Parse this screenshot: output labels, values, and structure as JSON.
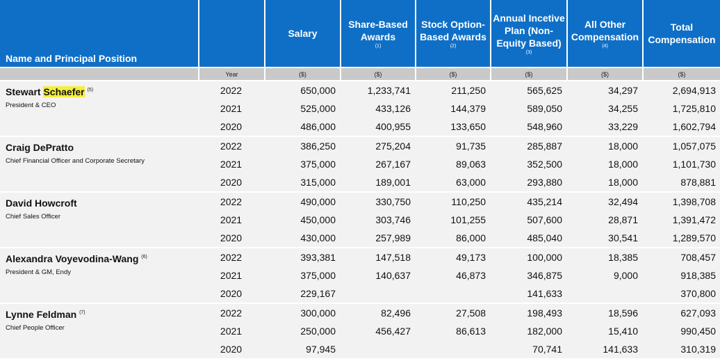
{
  "header": {
    "name_col": "Name and Principal Position",
    "salary": "Salary",
    "share_based": "Share-Based Awards",
    "share_based_note": "(1)",
    "option_based": "Stock Option-Based Awards",
    "option_based_note": "(2)",
    "incentive": "Annual Incetive Plan (Non-Equity Based)",
    "incentive_note": "(3)",
    "other": "All Other Compensation",
    "other_note": "(4)",
    "total": "Total Compensation"
  },
  "units": {
    "year": "Year",
    "salary": "($)",
    "share_based": "($)",
    "option_based": "($)",
    "incentive": "($)",
    "other": "($)",
    "total": "($)"
  },
  "people": [
    {
      "name_pre": "Stewart ",
      "name_highlight": "Schaefer",
      "name_post": "",
      "footnote": "(5)",
      "title": "President & CEO",
      "rows": [
        {
          "year": "2022",
          "salary": "650,000",
          "share": "1,233,741",
          "option": "211,250",
          "incentive": "565,625",
          "other": "34,297",
          "total": "2,694,913"
        },
        {
          "year": "2021",
          "salary": "525,000",
          "share": "433,126",
          "option": "144,379",
          "incentive": "589,050",
          "other": "34,255",
          "total": "1,725,810"
        },
        {
          "year": "2020",
          "salary": "486,000",
          "share": "400,955",
          "option": "133,650",
          "incentive": "548,960",
          "other": "33,229",
          "total": "1,602,794"
        }
      ]
    },
    {
      "name_pre": "Craig DePratto",
      "name_highlight": "",
      "name_post": "",
      "footnote": "",
      "title": "Chief Financial Officer and Corporate Secretary",
      "rows": [
        {
          "year": "2022",
          "salary": "386,250",
          "share": "275,204",
          "option": "91,735",
          "incentive": "285,887",
          "other": "18,000",
          "total": "1,057,075"
        },
        {
          "year": "2021",
          "salary": "375,000",
          "share": "267,167",
          "option": "89,063",
          "incentive": "352,500",
          "other": "18,000",
          "total": "1,101,730"
        },
        {
          "year": "2020",
          "salary": "315,000",
          "share": "189,001",
          "option": "63,000",
          "incentive": "293,880",
          "other": "18,000",
          "total": "878,881"
        }
      ]
    },
    {
      "name_pre": "David Howcroft",
      "name_highlight": "",
      "name_post": "",
      "footnote": "",
      "title": "Chief Sales Officer",
      "rows": [
        {
          "year": "2022",
          "salary": "490,000",
          "share": "330,750",
          "option": "110,250",
          "incentive": "435,214",
          "other": "32,494",
          "total": "1,398,708"
        },
        {
          "year": "2021",
          "salary": "450,000",
          "share": "303,746",
          "option": "101,255",
          "incentive": "507,600",
          "other": "28,871",
          "total": "1,391,472"
        },
        {
          "year": "2020",
          "salary": "430,000",
          "share": "257,989",
          "option": "86,000",
          "incentive": "485,040",
          "other": "30,541",
          "total": "1,289,570"
        }
      ]
    },
    {
      "name_pre": "Alexandra Voyevodina-Wang",
      "name_highlight": "",
      "name_post": "",
      "footnote": "(6)",
      "title": "President & GM, Endy",
      "rows": [
        {
          "year": "2022",
          "salary": "393,381",
          "share": "147,518",
          "option": "49,173",
          "incentive": "100,000",
          "other": "18,385",
          "total": "708,457"
        },
        {
          "year": "2021",
          "salary": "375,000",
          "share": "140,637",
          "option": "46,873",
          "incentive": "346,875",
          "other": "9,000",
          "total": "918,385"
        },
        {
          "year": "2020",
          "salary": "229,167",
          "share": "",
          "option": "",
          "incentive": "141,633",
          "other": "",
          "total": "370,800"
        }
      ]
    },
    {
      "name_pre": "Lynne Feldman",
      "name_highlight": "",
      "name_post": "",
      "footnote": "(7)",
      "title": "Chief People Officer",
      "rows": [
        {
          "year": "2022",
          "salary": "300,000",
          "share": "82,496",
          "option": "27,508",
          "incentive": "198,493",
          "other": "18,596",
          "total": "627,093"
        },
        {
          "year": "2021",
          "salary": "250,000",
          "share": "456,427",
          "option": "86,613",
          "incentive": "182,000",
          "other": "15,410",
          "total": "990,450"
        },
        {
          "year": "2020",
          "salary": "97,945",
          "share": "",
          "option": "",
          "incentive": "70,741",
          "other": "141,633",
          "total": "310,319"
        }
      ]
    }
  ]
}
